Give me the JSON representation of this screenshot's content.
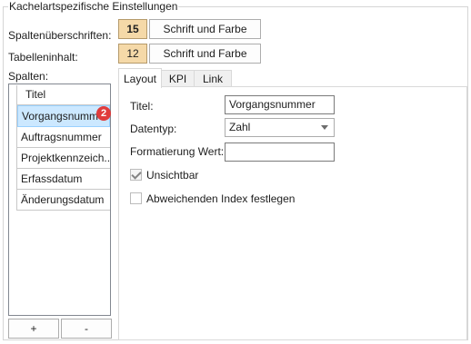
{
  "group": {
    "title": "Kachelartspezifische Einstellungen"
  },
  "settings": {
    "header_label": "Spaltenüberschriften:",
    "header_size": "15",
    "header_button": "Schrift und Farbe",
    "content_label": "Tabelleninhalt:",
    "content_size": "12",
    "content_button": "Schrift und Farbe",
    "columns_label": "Spalten:"
  },
  "columns_list": {
    "header": "Titel",
    "items": [
      "Vorgangsnummer",
      "Auftragsnummer",
      "Projektkennzeich...",
      "Erfassdatum",
      "Änderungsdatum"
    ],
    "badge": "2"
  },
  "buttons": {
    "add": "+",
    "remove": "-"
  },
  "tabs": [
    "Layout",
    "KPI",
    "Link"
  ],
  "layout": {
    "title_label": "Titel:",
    "title_value": "Vorgangsnummer",
    "datatype_label": "Datentyp:",
    "datatype_value": "Zahl",
    "format_label": "Formatierung Wert:",
    "format_value": "",
    "invisible_label": "Unsichtbar",
    "invisible_checked": true,
    "index_label": "Abweichenden Index festlegen",
    "index_checked": false
  }
}
